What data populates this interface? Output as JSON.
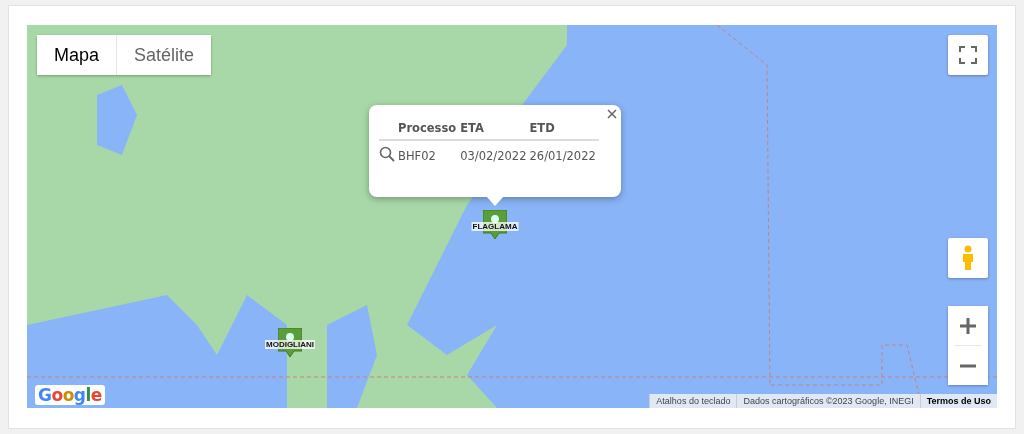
{
  "map_type_tabs": [
    {
      "label": "Mapa",
      "selected": true
    },
    {
      "label": "Satélite",
      "selected": false
    }
  ],
  "info_window": {
    "columns": [
      "Processo",
      "ETA",
      "ETD"
    ],
    "rows": [
      {
        "cells": [
          "BHF02",
          "03/02/2022",
          "26/01/2022"
        ]
      }
    ]
  },
  "markers": [
    {
      "label": "FLAGLAMA"
    },
    {
      "label": "MODIGLIANI"
    }
  ],
  "footer": {
    "logo": "Google",
    "links": [
      "Atalhos do teclado",
      "Dados cartográficos ©2023 Google, INEGI",
      "Termos de Uso"
    ]
  }
}
